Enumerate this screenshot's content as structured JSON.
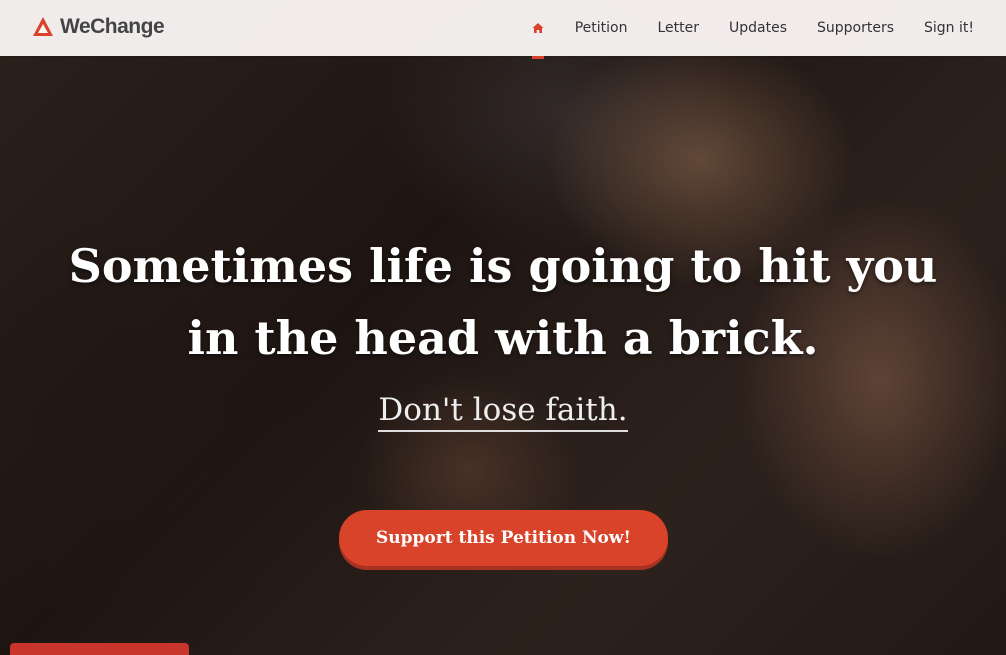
{
  "brand": {
    "name": "WeChange",
    "accent": "#d9432a"
  },
  "nav": {
    "home_icon": "home-icon",
    "items": [
      "Petition",
      "Letter",
      "Updates",
      "Supporters",
      "Sign it!"
    ]
  },
  "hero": {
    "headline_line1": "Sometimes life is going to hit you",
    "headline_line2": "in the head with a brick.",
    "subline": "Don't lose faith.",
    "cta_label": "Support this Petition Now!"
  }
}
